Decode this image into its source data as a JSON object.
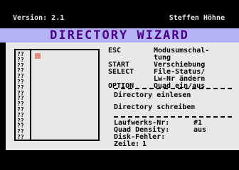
{
  "header": {
    "version": "Version: 2.1",
    "author": "Steffen Höhne"
  },
  "title": "DIRECTORY WIZARD",
  "directory_list": {
    "placeholder_entries": [
      "??",
      "??",
      "??",
      "??",
      "??",
      "??",
      "??",
      "??",
      "??",
      "??",
      "??",
      "??",
      "??",
      "??",
      "??",
      "??"
    ]
  },
  "menu": {
    "items": [
      {
        "key": "ESC",
        "desc": "Modusumschal-"
      },
      {
        "key": "",
        "desc": "tung"
      },
      {
        "key": "START",
        "desc": "Verschiebung"
      },
      {
        "key": "SELECT",
        "desc": "File-Status/"
      },
      {
        "key": "",
        "desc": "Lw-Nr ändern"
      },
      {
        "key": "OPTION",
        "desc": "Quad ein/aus"
      }
    ]
  },
  "actions": {
    "read": "Directory einlesen",
    "write": "Directory schreiben"
  },
  "status": {
    "drive_label": "Laufwerks-Nr:",
    "drive_value": "#1",
    "quad_label": "Quad Density:",
    "quad_value": "aus",
    "error_label": "Disk-Fehler:",
    "error_value": "",
    "line_label": "Zeile:",
    "line_value": "1"
  },
  "colors": {
    "background": "#000000",
    "panel": "#e8e8e8",
    "title_bar": "#b4b2f4",
    "title_text": "#4a0088",
    "cursor": "#e48c84"
  }
}
